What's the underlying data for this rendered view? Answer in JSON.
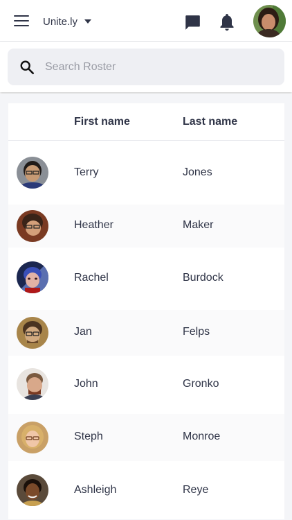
{
  "header": {
    "org_name": "Unite.ly"
  },
  "search": {
    "placeholder": "Search Roster",
    "value": ""
  },
  "table": {
    "columns": [
      "First name",
      "Last name"
    ],
    "rows": [
      {
        "first": "Terry",
        "last": "Jones"
      },
      {
        "first": "Heather",
        "last": "Maker"
      },
      {
        "first": "Rachel",
        "last": "Burdock"
      },
      {
        "first": "Jan",
        "last": "Felps"
      },
      {
        "first": "John",
        "last": "Gronko"
      },
      {
        "first": "Steph",
        "last": "Monroe"
      },
      {
        "first": "Ashleigh",
        "last": "Reye"
      }
    ]
  },
  "colors": {
    "text": "#2f3447",
    "search_bg": "#eeeff3",
    "placeholder": "#9a9ca5",
    "page_bg": "#f4f5f8"
  },
  "icons": [
    "menu-icon",
    "chevron-down-icon",
    "chat-icon",
    "bell-icon",
    "search-icon"
  ]
}
